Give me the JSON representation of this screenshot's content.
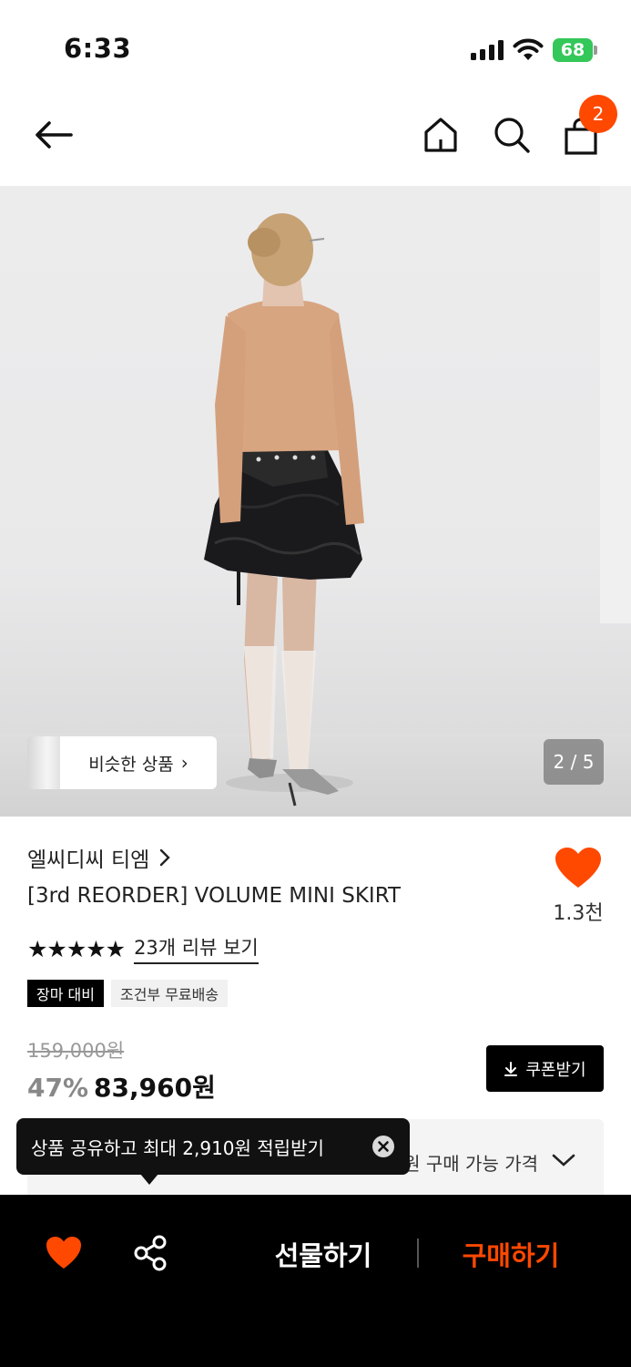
{
  "status_bar": {
    "time": "6:33",
    "battery": "68"
  },
  "header": {
    "cart_count": "2"
  },
  "gallery": {
    "similar_label": "비슷한 상품",
    "counter": "2 / 5"
  },
  "product": {
    "brand": "엘씨디씨 티엠",
    "title": "[3rd REORDER] VOLUME MINI SKIRT",
    "like_count": "1.3천",
    "stars": "★★★★★",
    "review_link": "23개 리뷰 보기",
    "tags": [
      "장마 대비",
      "조건부 무료배송"
    ],
    "original_price": "159,000원",
    "discount": "47%",
    "sale_price": "83,960원",
    "coupon_label": "쿠폰받기"
  },
  "price_box": {
    "label": "원 구매 가능 가격"
  },
  "tooltip": {
    "text": "상품 공유하고 최대 2,910원 적립받기"
  },
  "bottom_bar": {
    "gift_label": "선물하기",
    "buy_label": "구매하기"
  },
  "colors": {
    "accent": "#ff4800",
    "battery": "#34c759"
  }
}
